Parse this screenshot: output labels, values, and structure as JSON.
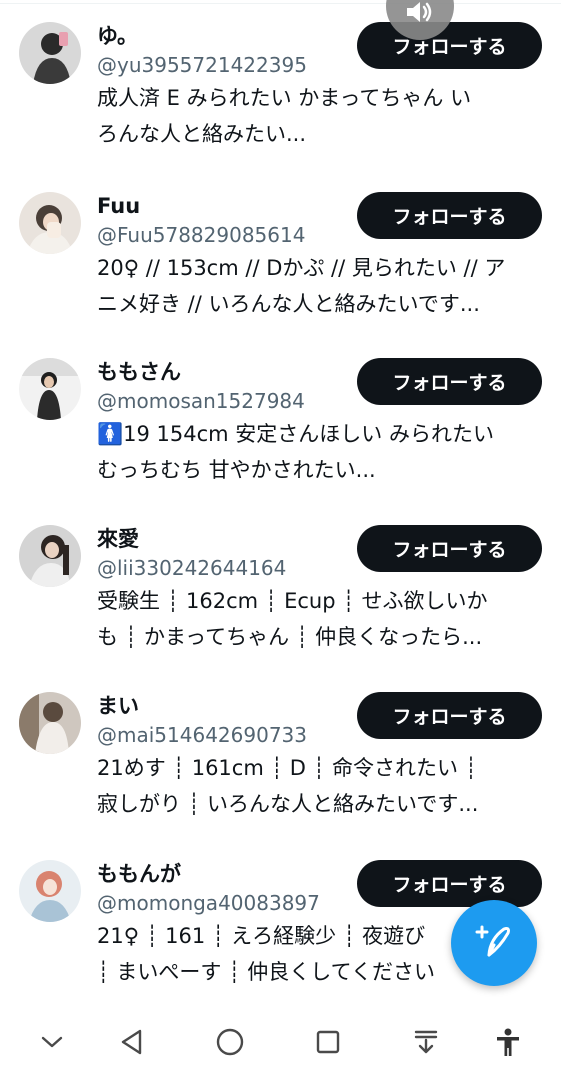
{
  "users": [
    {
      "name": "ゆ。",
      "handle": "@yu3955721422395",
      "bio_lines": [
        "成人済 E みられたい かまってちゃん い",
        "ろんな人と絡みたい..."
      ],
      "follow_label": "フォローする"
    },
    {
      "name": "Fuu",
      "handle": "@Fuu578829085614",
      "bio_lines": [
        "20♀ // 153cm // Dかぷ // 見られたい // ア",
        "ニメ好き // いろんな人と絡みたいです..."
      ],
      "follow_label": "フォローする"
    },
    {
      "name": "ももさん",
      "handle": "@momosan1527984",
      "bio_lines": [
        "🚺19 154cm 安定さんほしい みられたい",
        "むっちむち 甘やかされたい..."
      ],
      "follow_label": "フォローする"
    },
    {
      "name": "來愛",
      "handle": "@lii330242644164",
      "bio_lines": [
        "受験生 ┊ 162cm ┊ Ecup ┊ せふ欲しいか",
        "も ┊ かまってちゃん ┊ 仲良くなったら..."
      ],
      "follow_label": "フォローする"
    },
    {
      "name": "まい",
      "handle": "@mai514642690733",
      "bio_lines": [
        "21めす ┊ 161cm ┊ D ┊ 命令されたい ┊",
        "寂しがり ┊ いろんな人と絡みたいです..."
      ],
      "follow_label": "フォローする"
    },
    {
      "name": "ももんが",
      "handle": "@momonga40083897",
      "bio_lines": [
        "21♀ ┊ 161 ┊ えろ経験少 ┊ 夜遊び",
        "┊ まいぺーす ┊ 仲良くしてください"
      ],
      "follow_label": "フォローする"
    }
  ],
  "icons": {
    "volume": "volume-icon",
    "compose": "compose-tweet-icon",
    "nav": [
      "chevron-down-icon",
      "back-icon",
      "home-icon",
      "recents-icon",
      "download-icon",
      "accessibility-icon"
    ]
  },
  "colors": {
    "follow_bg": "#0f1419",
    "handle": "#536471",
    "accent": "#1d9bf0"
  }
}
